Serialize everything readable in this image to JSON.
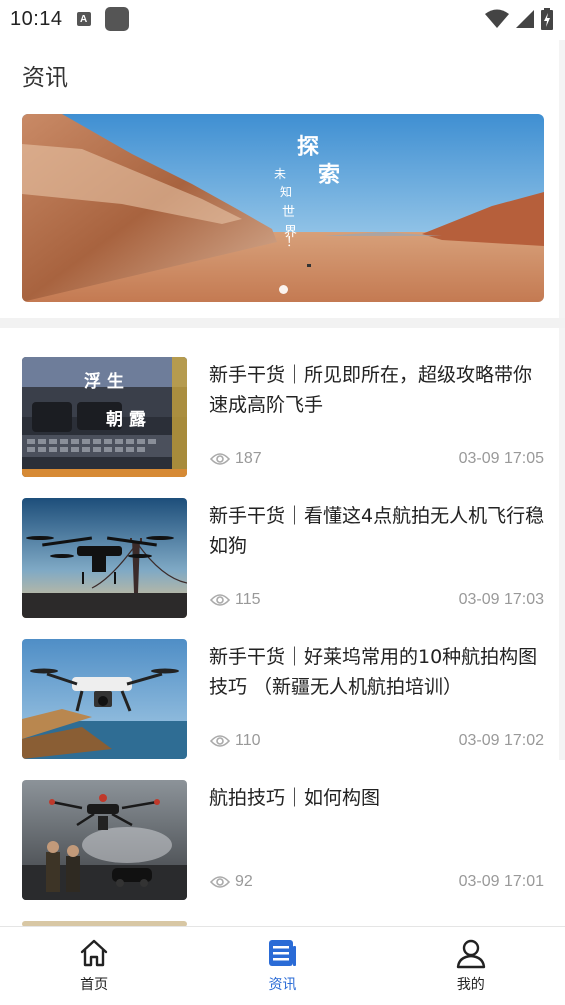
{
  "status_bar": {
    "time": "10:14",
    "notif_letter": "A"
  },
  "header": {
    "title": "资讯"
  },
  "banner": {
    "line1": "探索",
    "line2": "未知世界！",
    "slides": 1,
    "active_slide": 1
  },
  "news": [
    {
      "title": "新手干货｜所见即所在，超级攻略带你速成高阶飞手",
      "views": "187",
      "date": "03-09 17:05",
      "thumb_text_1": "浮 生",
      "thumb_text_2": "朝 露"
    },
    {
      "title": "新手干货｜看懂这4点航拍无人机飞行稳如狗",
      "views": "115",
      "date": "03-09 17:03"
    },
    {
      "title": "新手干货｜好莱坞常用的10种航拍构图技巧 （新疆无人机航拍培训）",
      "views": "110",
      "date": "03-09 17:02"
    },
    {
      "title": "航拍技巧｜如何构图",
      "views": "92",
      "date": "03-09 17:01"
    }
  ],
  "tabbar": {
    "tabs": [
      {
        "label": "首页",
        "icon": "home-icon",
        "active": false
      },
      {
        "label": "资讯",
        "icon": "news-icon",
        "active": true
      },
      {
        "label": "我的",
        "icon": "user-icon",
        "active": false
      }
    ],
    "active_color": "#2a6bd6"
  }
}
